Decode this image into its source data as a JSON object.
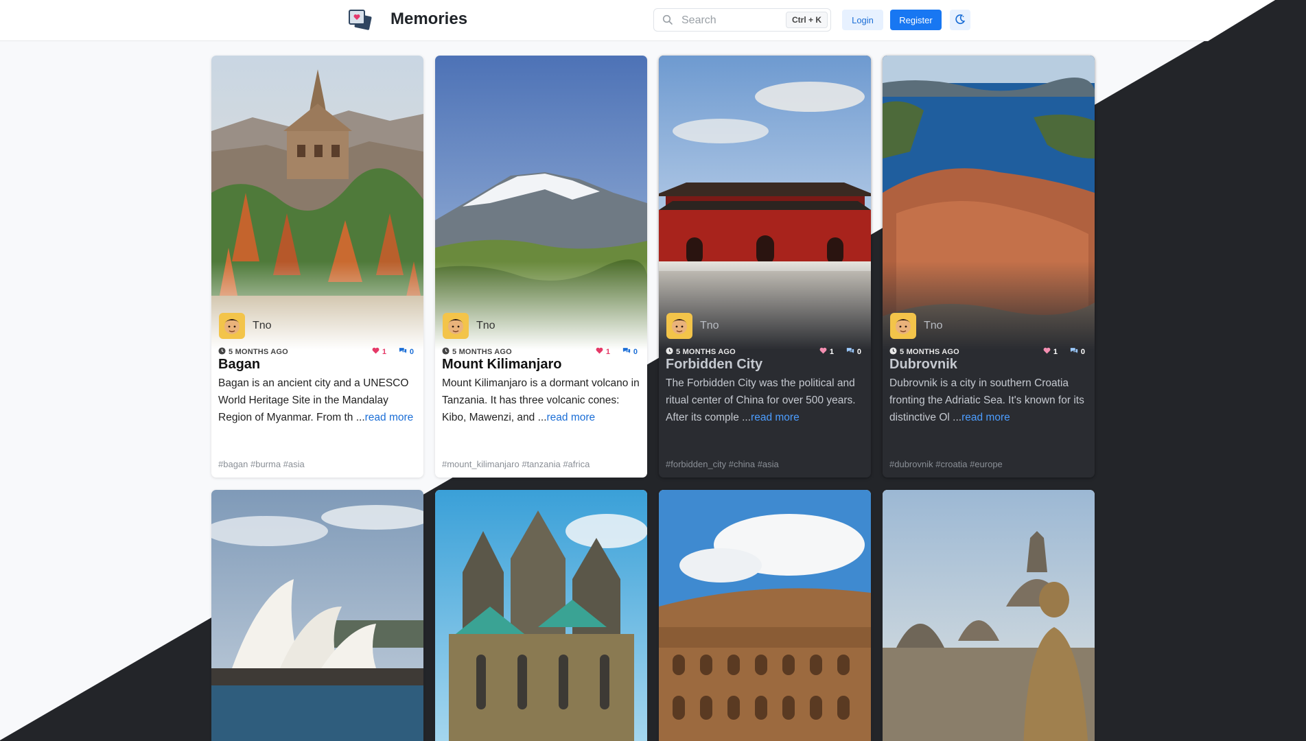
{
  "header": {
    "brand": "Memories",
    "search_placeholder": "Search",
    "shortcut": "Ctrl + K",
    "login_label": "Login",
    "register_label": "Register"
  },
  "colors": {
    "accent": "#1877f2",
    "like": "#e53967",
    "dark_bg": "#232529"
  },
  "cards": [
    {
      "author": "Tno",
      "time": "5 MONTHS AGO",
      "likes": "1",
      "comments": "0",
      "title": "Bagan",
      "description": "Bagan is an ancient city and a UNESCO World Heritage Site in the Mandalay Region of Myanmar. From th ...",
      "read_more": "read more",
      "tags": "#bagan #burma #asia"
    },
    {
      "author": "Tno",
      "time": "5 MONTHS AGO",
      "likes": "1",
      "comments": "0",
      "title": "Mount Kilimanjaro",
      "description": "Mount Kilimanjaro is a dormant volcano in Tanzania. It has three volcanic cones: Kibo, Mawenzi, and ...",
      "read_more": "read more",
      "tags": "#mount_kilimanjaro #tanzania #africa"
    },
    {
      "author": "Tno",
      "time": "5 MONTHS AGO",
      "likes": "1",
      "comments": "0",
      "title": "Forbidden City",
      "description": "The Forbidden City was the political and ritual center of China for over 500 years. After its comple ...",
      "read_more": "read more",
      "tags": "#forbidden_city #china #asia"
    },
    {
      "author": "Tno",
      "time": "5 MONTHS AGO",
      "likes": "1",
      "comments": "0",
      "title": "Dubrovnik",
      "description": "Dubrovnik is a city in southern Croatia fronting the Adriatic Sea. It's known for its distinctive Ol ...",
      "read_more": "read more",
      "tags": "#dubrovnik #croatia #europe"
    }
  ],
  "icons": {
    "logo": "memories-logo-icon",
    "search": "search-icon",
    "theme": "moon-icon",
    "clock": "clock-icon",
    "heart": "heart-icon",
    "comment": "comment-icon"
  }
}
